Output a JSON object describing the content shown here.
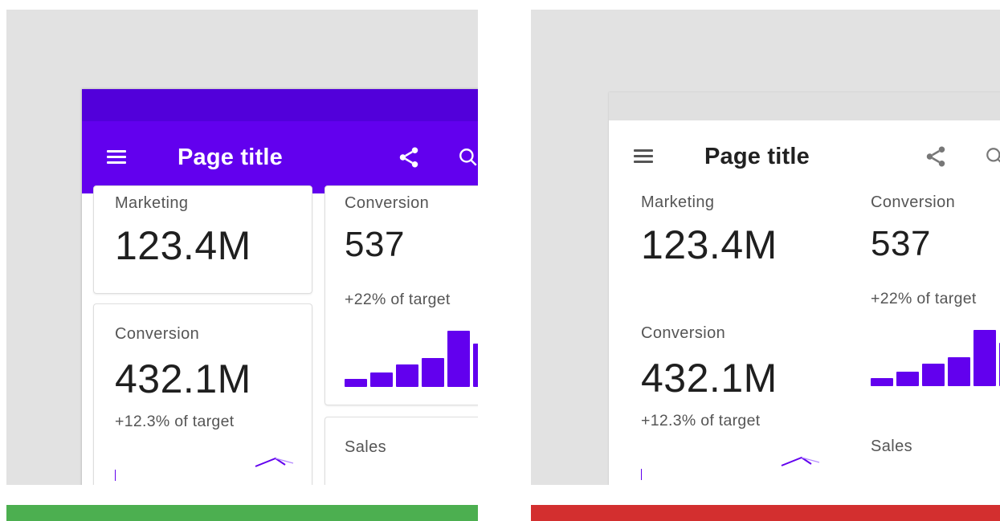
{
  "variants": [
    {
      "id": "left",
      "appbar": {
        "title": "Page title",
        "menu_icon": "menu-icon",
        "share_icon": "share-icon",
        "search_icon": "search-icon"
      },
      "cards": {
        "marketing": {
          "label": "Marketing",
          "value": "123.4M"
        },
        "conversion_a": {
          "label": "Conversion",
          "value": "432.1M",
          "sub": "+12.3% of target"
        },
        "conversion_b": {
          "label": "Conversion",
          "value": "537",
          "sub": "+22% of target"
        },
        "sales": {
          "label": "Sales"
        }
      }
    },
    {
      "id": "right",
      "appbar": {
        "title": "Page title",
        "menu_icon": "menu-icon",
        "share_icon": "share-icon",
        "search_icon": "search-icon"
      },
      "cards": {
        "marketing": {
          "label": "Marketing",
          "value": "123.4M"
        },
        "conversion_a": {
          "label": "Conversion",
          "value": "432.1M",
          "sub": "+12.3% of target"
        },
        "conversion_b": {
          "label": "Conversion",
          "value": "537",
          "sub": "+22% of target"
        },
        "sales": {
          "label": "Sales"
        }
      }
    }
  ],
  "colors": {
    "primary": "#6200ee",
    "primary_dark": "#5200da",
    "good": "#4caf50",
    "bad": "#d32f2f"
  },
  "mini_bar_chart": {
    "values": [
      10,
      18,
      28,
      36,
      70,
      54
    ]
  }
}
